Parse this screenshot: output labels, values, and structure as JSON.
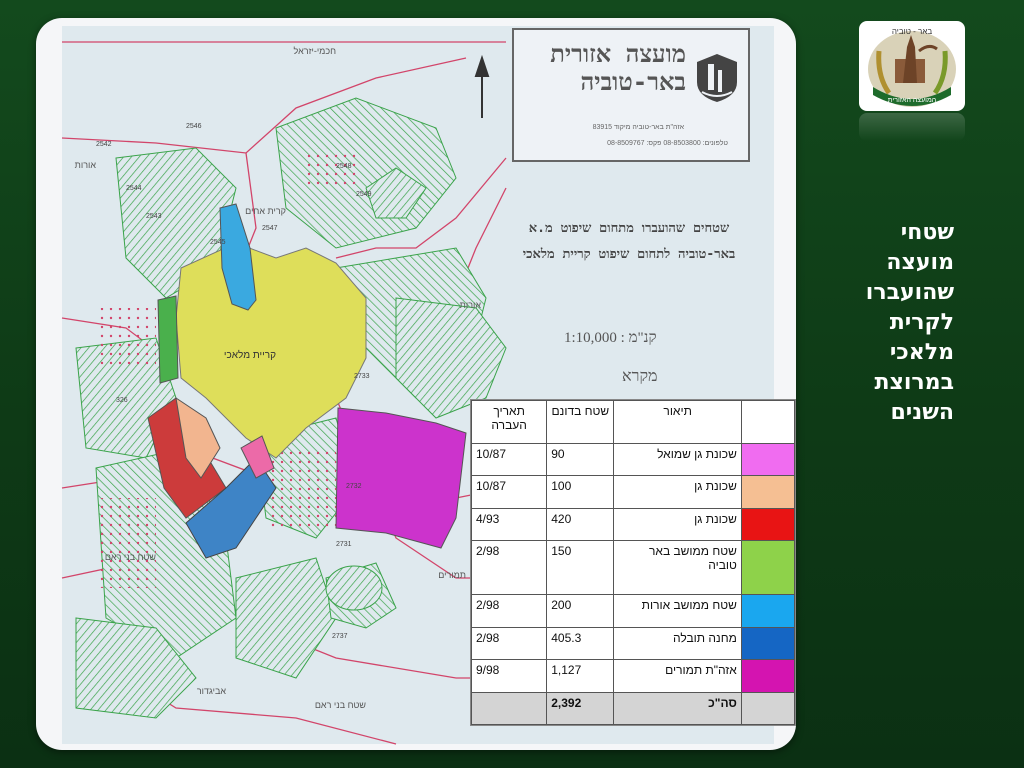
{
  "slide": {
    "title": "שטחי מועצה שהועברו לקרית מלאכי במרוצת השנים"
  },
  "logo": {
    "icon": "council-emblem-icon",
    "top_text": "באר - טוביה",
    "bottom_text": "המועצה האזורית"
  },
  "map": {
    "council_name": "מועצה אזורית באר-טוביה",
    "address": "אזה\"ת באר-טוביה מיקוד 83915",
    "phones": "טלפונים: 08-8503800 פקס: 08-8509767",
    "subject": "שטחים שהועברו מתחום שיפוט מ.א באר-טוביה לתחום שיפוט קריית מלאכי",
    "scale": "קנ\"מ : 1:10,000",
    "legend_title": "מקרא",
    "city_label": "קריית מלאכי",
    "place_labels": {
      "orot_west": "אורות",
      "orot_north": "אורות",
      "kfar_aharon": "קרית אחים",
      "bnei_reem": "שטח בני ראם",
      "avigdor": "אביגדור",
      "bnei_reem_south": "שטח בני ראם",
      "tamurim": "תמורים",
      "north_label": "חכמי-יזראל"
    },
    "plot_numbers": [
      "2542",
      "2546",
      "2544",
      "2549",
      "2545",
      "2547",
      "2543",
      "2548",
      "2733",
      "2731",
      "2737",
      "326",
      "2732"
    ],
    "colors": {
      "map_bg": "#dfe9ee",
      "parcel_green": "#3aa34a",
      "boundary": "#d2456a",
      "yellow_area": "#dede5a",
      "magenta_area": "#cc33cc",
      "blue_area": "#3e84c6",
      "light_blue_area": "#3aa9e0",
      "red_area": "#cc3b3b",
      "peach_area": "#f2b58f",
      "pink_area": "#ec6aa8",
      "green_strip": "#4ab04c"
    }
  },
  "area_table": {
    "headers": {
      "swatch": "",
      "description": "תיאור",
      "area": "שטח בדונם",
      "date": "תאריך העברה"
    },
    "rows": [
      {
        "color": "#f06cf0",
        "description": "שכונת גן שמואל",
        "area": "90",
        "date": "10/87"
      },
      {
        "color": "#f5bf93",
        "description": "שכונת גן",
        "area": "100",
        "date": "10/87"
      },
      {
        "color": "#e81414",
        "description": "שכונת גן",
        "area": "420",
        "date": "4/93"
      },
      {
        "color": "#8ed24a",
        "description": "שטח ממושב באר טוביה",
        "area": "150",
        "date": "2/98"
      },
      {
        "color": "#1aa7ef",
        "description": "שטח ממושב אורות",
        "area": "200",
        "date": "2/98"
      },
      {
        "color": "#1566c4",
        "description": "מחנה תובלה",
        "area": "405.3",
        "date": "2/98"
      },
      {
        "color": "#d414b0",
        "description": "אזה\"ת תמורים",
        "area": "1,127",
        "date": "9/98"
      }
    ],
    "total": {
      "label": "סה\"כ",
      "area": "2,392",
      "date": ""
    }
  }
}
